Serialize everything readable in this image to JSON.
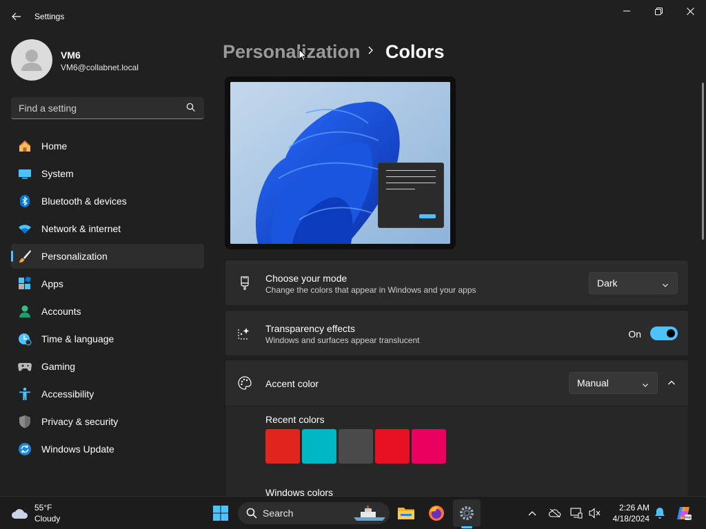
{
  "window": {
    "title": "Settings"
  },
  "user": {
    "name": "VM6",
    "email": "VM6@collabnet.local"
  },
  "search": {
    "placeholder": "Find a setting"
  },
  "sidebar": {
    "items": [
      {
        "label": "Home",
        "icon": "home-icon"
      },
      {
        "label": "System",
        "icon": "system-icon"
      },
      {
        "label": "Bluetooth & devices",
        "icon": "bluetooth-icon"
      },
      {
        "label": "Network & internet",
        "icon": "wifi-icon"
      },
      {
        "label": "Personalization",
        "icon": "brush-icon",
        "active": true
      },
      {
        "label": "Apps",
        "icon": "apps-icon"
      },
      {
        "label": "Accounts",
        "icon": "accounts-icon"
      },
      {
        "label": "Time & language",
        "icon": "time-language-icon"
      },
      {
        "label": "Gaming",
        "icon": "gaming-icon"
      },
      {
        "label": "Accessibility",
        "icon": "accessibility-icon"
      },
      {
        "label": "Privacy & security",
        "icon": "shield-icon"
      },
      {
        "label": "Windows Update",
        "icon": "update-icon"
      }
    ]
  },
  "header": {
    "parent": "Personalization",
    "current": "Colors"
  },
  "settings": {
    "mode": {
      "title": "Choose your mode",
      "description": "Change the colors that appear in Windows and your apps",
      "value": "Dark"
    },
    "transparency": {
      "title": "Transparency effects",
      "description": "Windows and surfaces appear translucent",
      "state": "On"
    },
    "accent": {
      "title": "Accent color",
      "value": "Manual",
      "recent_label": "Recent colors",
      "recent_colors": [
        "#e0241e",
        "#00b7c3",
        "#4a4a4a",
        "#e81123",
        "#ea005e"
      ],
      "windows_colors_label": "Windows colors"
    }
  },
  "colors": {
    "accent": "#4cc2ff",
    "background": "#202020",
    "card": "#2b2b2b"
  },
  "taskbar": {
    "weather_temp": "55°F",
    "weather_desc": "Cloudy",
    "search_label": "Search",
    "time": "2:26 AM",
    "date": "4/18/2024"
  }
}
